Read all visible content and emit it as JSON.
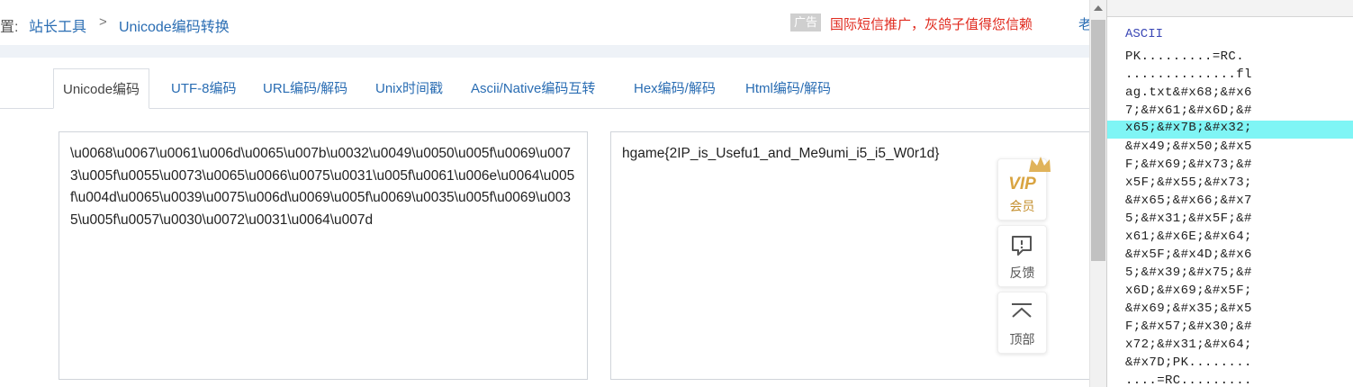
{
  "breadcrumb": {
    "prefix": "置:",
    "site_tools": "站长工具",
    "separator": ">",
    "current": "Unicode编码转换"
  },
  "ad": {
    "tag": "广告",
    "text": "国际短信推广，灰鸽子值得您信赖",
    "more": "老"
  },
  "tabs": [
    {
      "label": "Unicode编码",
      "active": true
    },
    {
      "label": "UTF-8编码"
    },
    {
      "label": "URL编码/解码"
    },
    {
      "label": "Unix时间戳"
    },
    {
      "label": "Ascii/Native编码互转"
    },
    {
      "label": "Hex编码/解码"
    },
    {
      "label": "Html编码/解码"
    }
  ],
  "input_text": "\\u0068\\u0067\\u0061\\u006d\\u0065\\u007b\\u0032\\u0049\\u0050\\u005f\\u0069\\u0073\\u005f\\u0055\\u0073\\u0065\\u0066\\u0075\\u0031\\u005f\\u0061\\u006e\\u0064\\u005f\\u004d\\u0065\\u0039\\u0075\\u006d\\u0069\\u005f\\u0069\\u0035\\u005f\\u0069\\u0035\\u005f\\u0057\\u0030\\u0072\\u0031\\u0064\\u007d",
  "output_text": "hgame{2IP_is_Usefu1_and_Me9umi_i5_i5_W0r1d}",
  "side": {
    "vip_badge": "VIP",
    "vip_label": "会员",
    "feedback_label": "反馈",
    "top_label": "顶部"
  },
  "hex_panel": {
    "header": "ASCII",
    "rows": [
      "PK.........=RC.",
      "..............fl",
      "ag.txt&#x68;&#x6",
      "7;&#x61;&#x6D;&#",
      "x65;&#x7B;&#x32;",
      "&#x49;&#x50;&#x5",
      "F;&#x69;&#x73;&#",
      "x5F;&#x55;&#x73;",
      "&#x65;&#x66;&#x7",
      "5;&#x31;&#x5F;&#",
      "x61;&#x6E;&#x64;",
      "&#x5F;&#x4D;&#x6",
      "5;&#x39;&#x75;&#",
      "x6D;&#x69;&#x5F;",
      "&#x69;&#x35;&#x5",
      "F;&#x57;&#x30;&#",
      "x72;&#x31;&#x64;",
      "&#x7D;PK........",
      "....=RC........."
    ],
    "highlight_row": 4,
    "highlight_color": "#7ff5f5"
  },
  "colors": {
    "link": "#2a6db3",
    "ad_red": "#e02a1e",
    "vip_gold": "#d9a441"
  }
}
